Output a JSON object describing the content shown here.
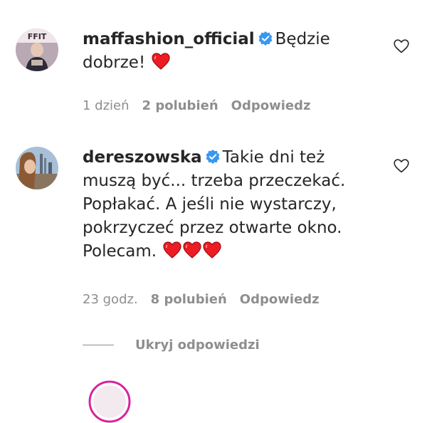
{
  "comments": [
    {
      "username": "maffashion_official",
      "verified": true,
      "text": "Będzie dobrze!",
      "hearts": 1,
      "time": "1 dzień",
      "likes": "2 polubień",
      "reply_label": "Odpowiedz"
    },
    {
      "username": "dereszowska",
      "verified": true,
      "text": "Takie dni też muszą być... trzeba przeczekać. Popłakać. A jeśli nie wystarczy, pokrzyczeć przez otwarte okno. Polecam.",
      "hearts": 3,
      "time": "23 godz.",
      "likes": "8 polubień",
      "reply_label": "Odpowiedz"
    }
  ],
  "hide_replies_label": "Ukryj odpowiedzi",
  "colors": {
    "text": "#262626",
    "muted": "#8e8e8e",
    "verified_blue": "#3897f0",
    "heart_red": "#ed1c24"
  }
}
